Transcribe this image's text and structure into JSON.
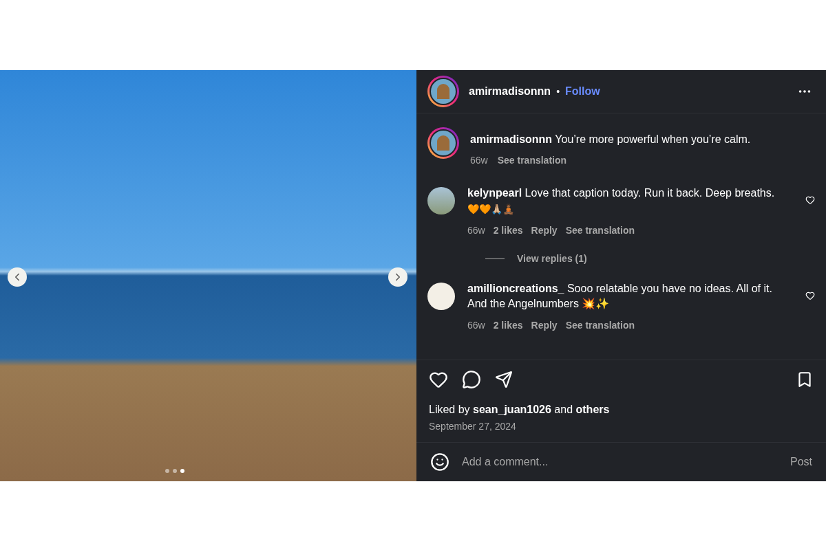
{
  "photo": {
    "dots": [
      {
        "selected": false
      },
      {
        "selected": false
      },
      {
        "selected": true
      }
    ]
  },
  "header": {
    "username": "amirmadisonnn",
    "separator": "•",
    "follow": "Follow"
  },
  "caption": {
    "text": "**amirmadisonnn** You’re more powerful when you’re calm.",
    "time": "66w",
    "translate": "See translation"
  },
  "comments": [
    {
      "text": "**kelynpearl** Love that caption today. Run it back. Deep breaths.",
      "emoji": "🧡🧡🙏🏼🧘🏾",
      "time": "66w",
      "likes": "2 likes",
      "reply": "Reply",
      "translate": "See translation",
      "view_replies": "View replies (1)",
      "kind": "photo"
    },
    {
      "text": "**amillioncreations_** Sooo relatable you have no ideas. All of it. And the Angelnumbers 💥✨",
      "time": "66w",
      "likes": "2 likes",
      "reply": "Reply",
      "translate": "See translation",
      "kind": "logo"
    }
  ],
  "likes": "Liked by **sean_juan1026** and **others**",
  "date": "September 27, 2024",
  "comment_box": {
    "placeholder": "Add a comment...",
    "post": "Post"
  }
}
